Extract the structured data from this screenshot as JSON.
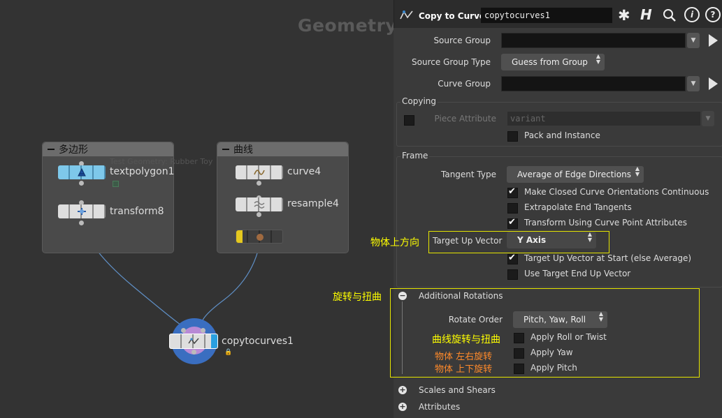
{
  "network": {
    "context_label": "Geometry",
    "boxes": {
      "polygon": {
        "title": "多边形"
      },
      "curve": {
        "title": "曲线"
      }
    },
    "nodes": {
      "textpolygon": "textpolygon1",
      "transform": "transform8",
      "curve": "curve4",
      "resample": "resample4",
      "bypassed": "",
      "copytocurves": "copytocurves1"
    },
    "comment": "Test Geometry: Rubber Toy",
    "colors": {
      "textpolygon_node": "#7ec8ea",
      "bypass_flag": "#e5c81f",
      "selected_node_ring": "#3a6ec0",
      "display_flag": "#2aa0e0"
    }
  },
  "panel": {
    "node_type_label": "Copy to Curves",
    "node_name": "copytocurves1",
    "toolbar_icons": [
      "gear-icon",
      "help-h-icon",
      "search-icon",
      "info-icon",
      "help-icon"
    ],
    "source_group": {
      "label": "Source Group",
      "value": ""
    },
    "source_group_type": {
      "label": "Source Group Type",
      "value": "Guess from Group"
    },
    "curve_group": {
      "label": "Curve Group",
      "value": ""
    },
    "copying": {
      "label": "Copying",
      "piece_attribute_label": "Piece Attribute",
      "piece_attribute_value": "variant",
      "pack_and_instance": "Pack and Instance"
    },
    "frame": {
      "label": "Frame",
      "tangent_type_label": "Tangent Type",
      "tangent_type_value": "Average of Edge Directions",
      "make_closed": "Make Closed Curve Orientations Continuous",
      "extrapolate": "Extrapolate End Tangents",
      "transform_using": "Transform Using Curve Point Attributes",
      "target_up_vector_label": "Target Up Vector",
      "target_up_vector_value": "Y Axis",
      "target_up_at_start": "Target Up Vector at Start (else Average)",
      "use_target_end": "Use Target End Up Vector"
    },
    "additional_rotations": {
      "label": "Additional Rotations",
      "rotate_order_label": "Rotate Order",
      "rotate_order_value": "Pitch, Yaw, Roll",
      "apply_roll": "Apply Roll or Twist",
      "apply_yaw": "Apply Yaw",
      "apply_pitch": "Apply Pitch"
    },
    "scales_and_shears": "Scales and Shears",
    "attributes": "Attributes"
  },
  "annotations": {
    "up_direction": "物体上方向",
    "rotate_twist": "旋转与扭曲",
    "curve_rotate_twist": "曲线旋转与扭曲",
    "yaw_note": "物体 左右旋转",
    "pitch_note": "物体 上下旋转",
    "colors": {
      "highlight": "#ffff00",
      "note": "#ff8a2a"
    }
  }
}
